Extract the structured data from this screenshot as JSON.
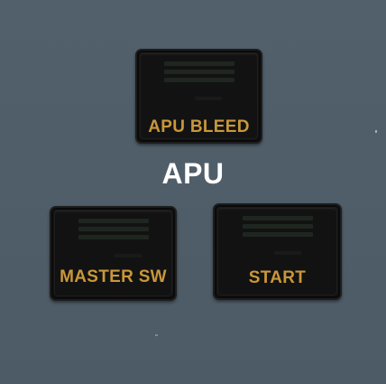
{
  "panel": {
    "title": "APU"
  },
  "buttons": {
    "apu_bleed": {
      "label": "APU BLEED"
    },
    "master_sw": {
      "label": "MASTER SW"
    },
    "start": {
      "label": "START"
    }
  },
  "colors": {
    "panel_bg": "#4f5d69",
    "button_bg": "#121212",
    "label_amber": "#c9973a",
    "title_white": "#ffffff"
  }
}
